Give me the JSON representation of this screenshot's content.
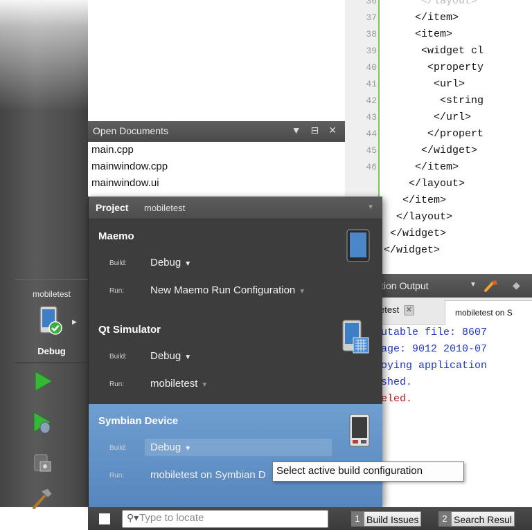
{
  "sidebar": {
    "open_documents_title": "Open Documents",
    "documents": [
      "main.cpp",
      "mainwindow.cpp",
      "mainwindow.ui"
    ]
  },
  "editor": {
    "lines": [
      {
        "n": "36",
        "code": "      </layout>"
      },
      {
        "n": "37",
        "code": "     </item>"
      },
      {
        "n": "38",
        "code": "     <item>"
      },
      {
        "n": "39",
        "code": "      <widget cl"
      },
      {
        "n": "40",
        "code": "       <property"
      },
      {
        "n": "41",
        "code": "        <url>"
      },
      {
        "n": "42",
        "code": "         <string"
      },
      {
        "n": "43",
        "code": "        </url>"
      },
      {
        "n": "44",
        "code": "       </propert"
      },
      {
        "n": "45",
        "code": "      </widget>"
      },
      {
        "n": "46",
        "code": "     </item>"
      },
      {
        "n": "",
        "code": "    </layout>"
      },
      {
        "n": "",
        "code": "   </item>"
      },
      {
        "n": "",
        "code": "  </layout>"
      },
      {
        "n": "",
        "code": " </widget>"
      },
      {
        "n": "",
        "code": "</widget>"
      }
    ]
  },
  "output": {
    "title": "tion Output",
    "tabs": [
      "etest",
      "mobiletest on S"
    ],
    "lines": [
      {
        "text": "utable file: 8607",
        "color": "#1f35c8"
      },
      {
        "text": "age: 9012 2010-07",
        "color": "#1f35c8"
      },
      {
        "text": "oying application",
        "color": "#1f35c8"
      },
      {
        "text": "shed.",
        "color": "#1f35c8"
      },
      {
        "text": "eled.",
        "color": "#c01818"
      }
    ]
  },
  "modebar": {
    "project": "mobiletest",
    "build": "Debug"
  },
  "popup": {
    "project_label": "Project",
    "project_name": "mobiletest",
    "build_label": "Build:",
    "run_label": "Run:",
    "targets": [
      {
        "name": "Maemo",
        "build": "Debug",
        "run": "New Maemo Run Configuration",
        "icon": "maemo-device-icon"
      },
      {
        "name": "Qt Simulator",
        "build": "Debug",
        "run": "mobiletest",
        "icon": "qt-simulator-icon"
      },
      {
        "name": "Symbian Device",
        "build": "Debug",
        "run": "mobiletest on Symbian D",
        "icon": "symbian-device-icon",
        "selected": true
      }
    ],
    "tooltip": "Select active build configuration"
  },
  "bottombar": {
    "locator_placeholder": "Type to locate",
    "buttons": [
      {
        "num": "1",
        "label": "Build Issues"
      },
      {
        "num": "2",
        "label": "Search Resul"
      }
    ]
  },
  "colors": {
    "selection": "#5f90c7",
    "dark_panel": "#3d3d3d",
    "line_number_border": "#7fc25a",
    "output_blue": "#1f35c8",
    "output_red": "#c01818"
  }
}
